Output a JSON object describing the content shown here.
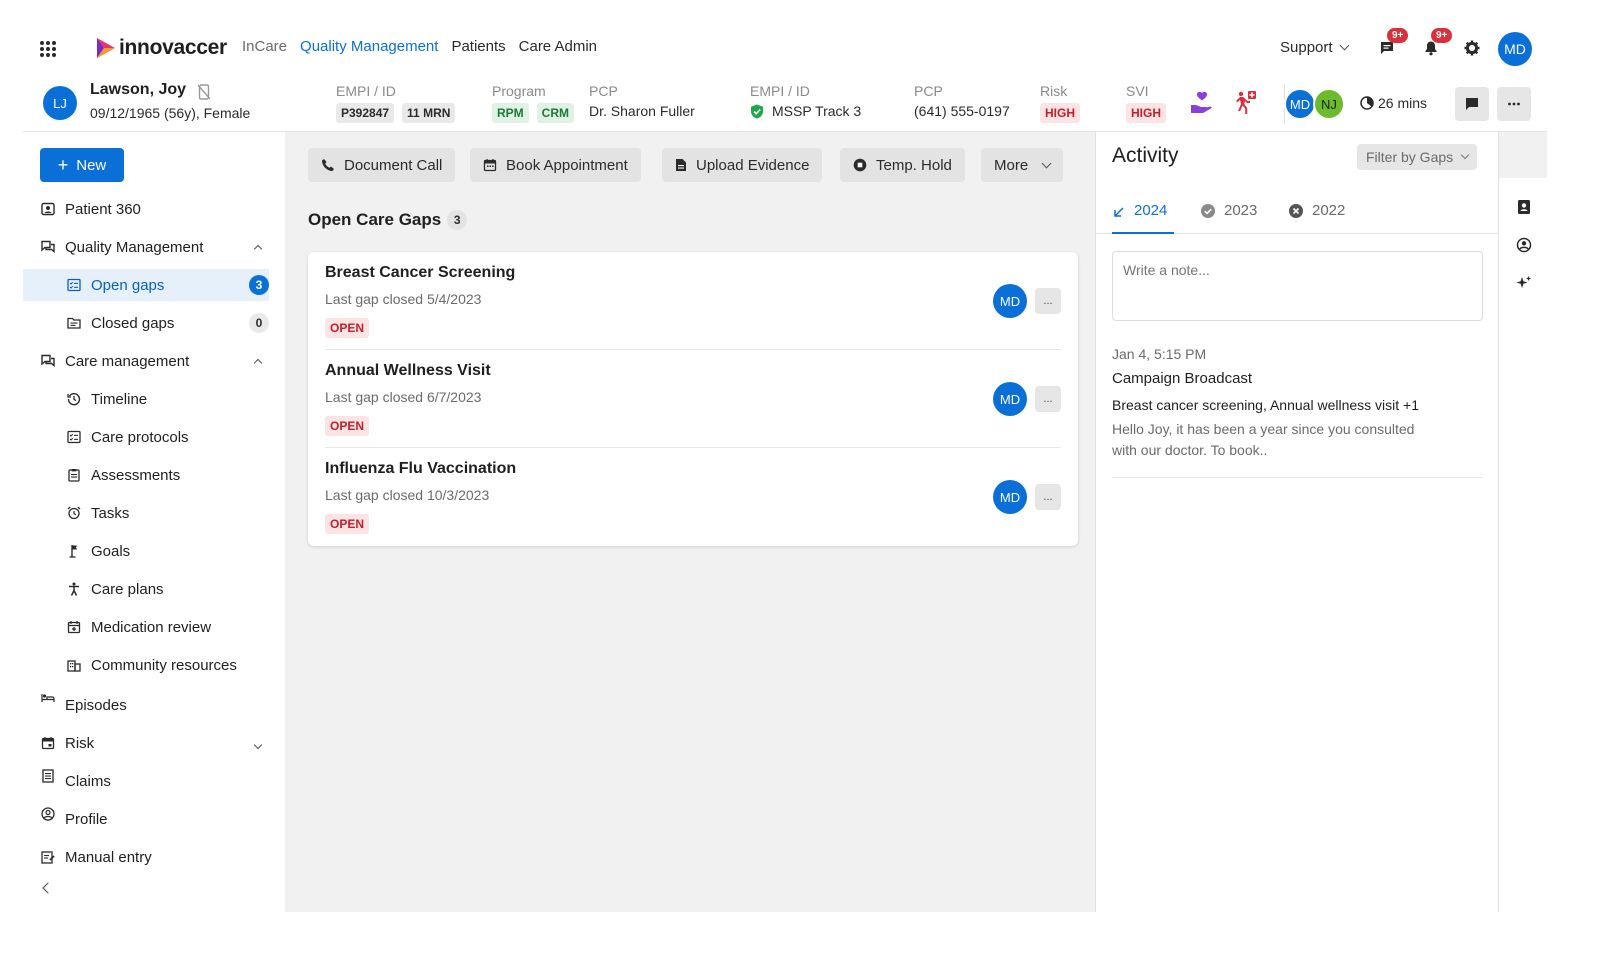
{
  "nav": {
    "brand": "innovaccer",
    "links": [
      "InCare",
      "Quality Management",
      "Patients",
      "Care Admin"
    ],
    "support": "Support",
    "messages_badge": "9+",
    "notifications_badge": "9+",
    "user_initials": "MD"
  },
  "patient": {
    "initials": "LJ",
    "name": "Lawson, Joy",
    "dob": "09/12/1965 (56y), Female",
    "empi_label": "EMPI / ID",
    "empi_id": "P392847",
    "mrn": "11 MRN",
    "program_label": "Program",
    "programs": [
      "RPM",
      "CRM"
    ],
    "pcp_label": "PCP",
    "pcp": "Dr. Sharon Fuller",
    "empi2_label": "EMPI / ID",
    "track": "MSSP Track 3",
    "pcp2_label": "PCP",
    "phone": "(641) 555-0197",
    "risk_label": "Risk",
    "risk": "HIGH",
    "svi_label": "SVI",
    "svi": "HIGH",
    "team": [
      "MD",
      "NJ"
    ],
    "timer": "26 mins"
  },
  "sidebar": {
    "new_label": "New",
    "items": [
      {
        "label": "Patient 360"
      },
      {
        "label": "Quality Management"
      },
      {
        "label": "Open gaps",
        "count": "3"
      },
      {
        "label": "Closed gaps",
        "count": "0"
      },
      {
        "label": "Care management"
      },
      {
        "label": "Timeline"
      },
      {
        "label": "Care protocols"
      },
      {
        "label": "Assessments"
      },
      {
        "label": "Tasks"
      },
      {
        "label": "Goals"
      },
      {
        "label": "Care plans"
      },
      {
        "label": "Medication review"
      },
      {
        "label": "Community resources"
      },
      {
        "label": "Episodes"
      },
      {
        "label": "Risk"
      },
      {
        "label": "Claims"
      },
      {
        "label": "Profile"
      },
      {
        "label": "Manual entry"
      }
    ]
  },
  "main": {
    "actions": [
      "Document Call",
      "Book Appointment",
      "Upload Evidence",
      "Temp. Hold",
      "More"
    ],
    "title": "Open Care Gaps",
    "title_count": "3",
    "gaps": [
      {
        "title": "Breast Cancer Screening",
        "last_closed": "Last gap closed 5/4/2023",
        "status": "OPEN",
        "assignee": "MD",
        "more": "..."
      },
      {
        "title": "Annual Wellness Visit",
        "last_closed": "Last gap closed 6/7/2023",
        "status": "OPEN",
        "assignee": "MD",
        "more": "..."
      },
      {
        "title": "Influenza Flu Vaccination",
        "last_closed": "Last gap closed 10/3/2023",
        "status": "OPEN",
        "assignee": "MD",
        "more": "..."
      }
    ]
  },
  "activity": {
    "title": "Activity",
    "filter": "Filter by Gaps",
    "tabs": [
      "2024",
      "2023",
      "2022"
    ],
    "note_placeholder": "Write a note...",
    "entry": {
      "time": "Jan 4, 5:15 PM",
      "type": "Campaign Broadcast",
      "subject": "Breast cancer screening, Annual wellness visit +1",
      "body": "Hello Joy, it has been a year since you consulted with our doctor. To book.."
    }
  },
  "colors": {
    "primary": "#0a6fd6",
    "danger": "#c0202a",
    "success": "#1b7a35",
    "brand_pink": "#e8336e"
  }
}
